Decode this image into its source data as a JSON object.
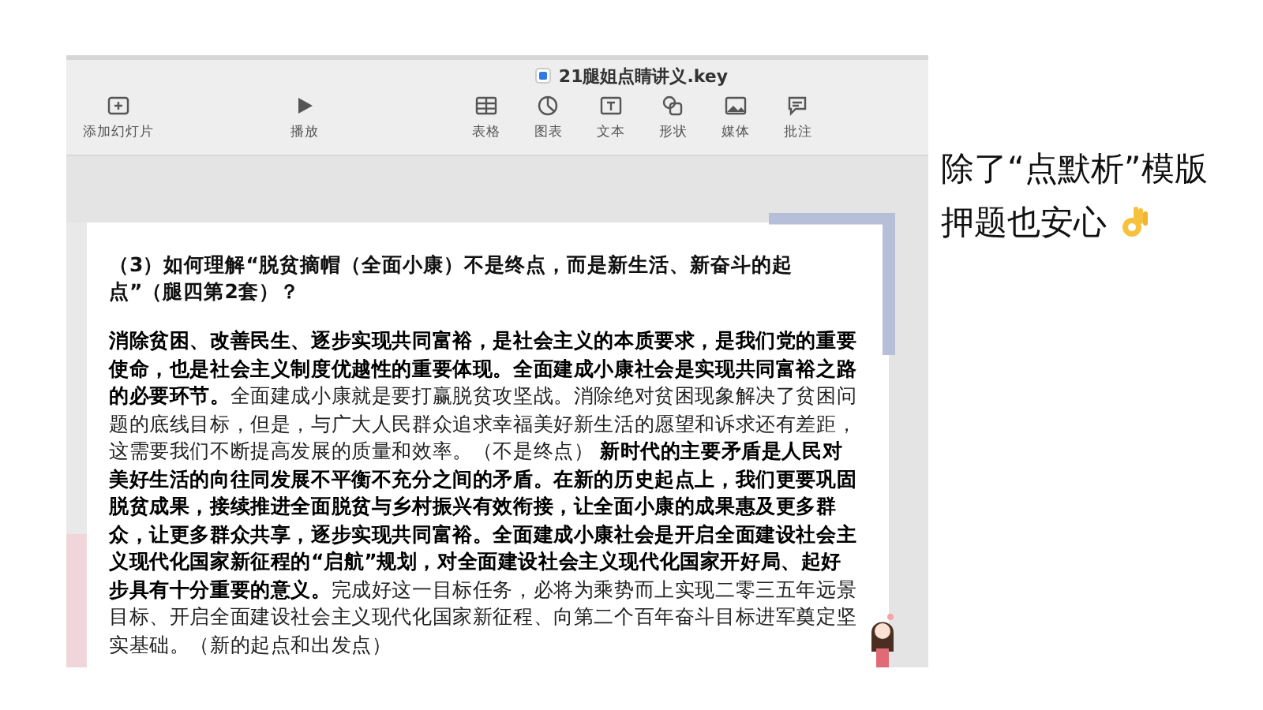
{
  "window": {
    "title": "21腿姐点睛讲义.key"
  },
  "toolbar": [
    {
      "label": "添加幻灯片",
      "kind": "add"
    },
    {
      "label": "播放",
      "kind": "play"
    },
    {
      "label": "表格",
      "kind": "table"
    },
    {
      "label": "图表",
      "kind": "chart"
    },
    {
      "label": "文本",
      "kind": "text"
    },
    {
      "label": "形状",
      "kind": "shape"
    },
    {
      "label": "媒体",
      "kind": "media"
    },
    {
      "label": "批注",
      "kind": "comment"
    }
  ],
  "slide": {
    "heading": "（3）如何理解“脱贫摘帽（全面小康）不是终点，而是新生活、新奋斗的起点”（腿四第2套）？",
    "body": "**消除贫困、改善民生、逐步实现共同富裕，是社会主义的本质要求，是我们党的重要使命，也是社会主义制度优越性的重要体现。全面建成小康社会是实现共同富裕之路的必要环节。**全面建成小康就是要打赢脱贫攻坚战。消除绝对贫困现象解决了贫困问题的底线目标，但是，与广大人民群众追求幸福美好新生活的愿望和诉求还有差距，这需要我们不断提高发展的质量和效率。（不是终点） **新时代的主要矛盾是人民对美好生活的向往同发展不平衡不充分之间的矛盾。在新的历史起点上，我们更要巩固脱贫成果，接续推进全面脱贫与乡村振兴有效衔接，让全面小康的成果惠及更多群众，让更多群众共享，逐步实现共同富裕。全面建成小康社会是开启全面建设社会主义现代化国家新征程的“启航”规划，对全面建设社会主义现代化国家开好局、起好步具有十分重要的意义。**完成好这一目标任务，必将为乘势而上实现二零三五年远景目标、开启全面建设社会主义现代化国家新征程、向第二个百年奋斗目标进军奠定坚实基础。（新的起点和出发点）"
  },
  "caption": [
    "除了“点默析”模版",
    "押题也安心"
  ]
}
